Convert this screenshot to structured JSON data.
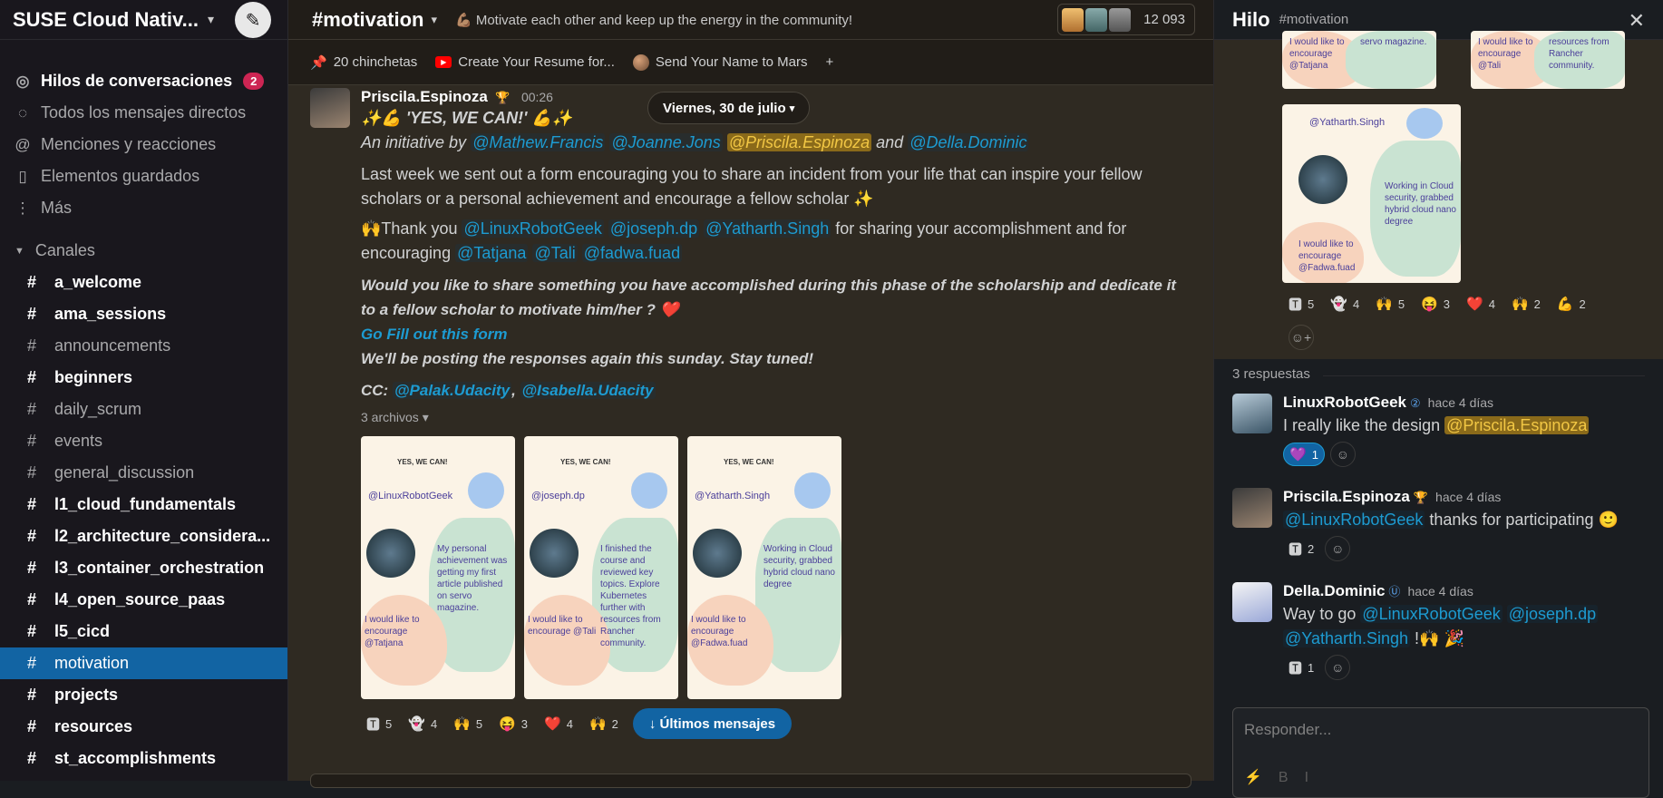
{
  "sidebar": {
    "workspace": "SUSE Cloud Nativ...",
    "nav": [
      {
        "label": "Hilos de conversaciones",
        "icon": "threads-icon",
        "glyph": "◎",
        "bold": true,
        "badge": "2"
      },
      {
        "label": "Todos los mensajes directos",
        "icon": "dm-icon",
        "glyph": "◌",
        "bold": false
      },
      {
        "label": "Menciones y reacciones",
        "icon": "at-icon",
        "glyph": "@",
        "bold": false
      },
      {
        "label": "Elementos guardados",
        "icon": "bookmark-icon",
        "glyph": "▯",
        "bold": false
      },
      {
        "label": "Más",
        "icon": "more-icon",
        "glyph": "⋮",
        "bold": false
      }
    ],
    "section_label": "Canales",
    "channels": [
      {
        "name": "a_welcome",
        "bold": true
      },
      {
        "name": "ama_sessions",
        "bold": true
      },
      {
        "name": "announcements",
        "bold": false
      },
      {
        "name": "beginners",
        "bold": true
      },
      {
        "name": "daily_scrum",
        "bold": false
      },
      {
        "name": "events",
        "bold": false
      },
      {
        "name": "general_discussion",
        "bold": false
      },
      {
        "name": "l1_cloud_fundamentals",
        "bold": true
      },
      {
        "name": "l2_architecture_considera...",
        "bold": true
      },
      {
        "name": "l3_container_orchestration",
        "bold": true
      },
      {
        "name": "l4_open_source_paas",
        "bold": true
      },
      {
        "name": "l5_cicd",
        "bold": true
      },
      {
        "name": "motivation",
        "bold": false,
        "active": true
      },
      {
        "name": "projects",
        "bold": true
      },
      {
        "name": "resources",
        "bold": true
      },
      {
        "name": "st_accomplishments",
        "bold": true
      }
    ]
  },
  "header": {
    "channel": "#motivation",
    "topic": "💪🏽 Motivate each other and keep up the energy in the community!",
    "member_count": "12 093"
  },
  "bookmarks": [
    {
      "label": "20 chinchetas",
      "icon": "pin-icon"
    },
    {
      "label": "Create Your Resume for...",
      "icon": "youtube-icon"
    },
    {
      "label": "Send Your Name to Mars",
      "icon": "planet-icon"
    },
    {
      "label": "+",
      "icon": "add-bookmark-icon"
    }
  ],
  "message": {
    "author": "Priscila.Espinoza",
    "time": "00:26",
    "date_divider": "Viernes, 30 de julio",
    "title": "✨💪 'YES, WE CAN!' 💪✨",
    "initiative_prefix": "An initiative by ",
    "initiative_mentions": [
      "@Mathew.Francis",
      "@Joanne.Jons",
      "@Priscila.Espinoza"
    ],
    "initiative_and": " and ",
    "initiative_last": "@Della.Dominic",
    "para1": "Last week we sent out a form encouraging you to share an incident from your life that can inspire your fellow scholars or a personal achievement and encourage a fellow scholar ✨",
    "thanks_prefix": "🙌Thank you ",
    "thanks_mentions": [
      "@LinuxRobotGeek",
      "@joseph.dp",
      "@Yatharth.Singh"
    ],
    "thanks_mid": " for sharing your accomplishment and for encouraging ",
    "encourage_mentions": [
      "@Tatjana",
      "@Tali",
      "@fadwa.fuad"
    ],
    "question": "Would you like to share something you have accomplished during this phase of the scholarship and dedicate it to a fellow scholar to motivate him/her ? ❤️",
    "form_link": "Go Fill out this form",
    "posting": "We'll be posting the responses again this sunday. Stay tuned!",
    "cc_label": "CC: ",
    "cc_mentions": [
      "@Palak.Udacity",
      "@Isabella.Udacity"
    ],
    "files_label": "3 archivos ▾",
    "files": [
      {
        "title": "YES, WE CAN!",
        "who": "@LinuxRobotGeek",
        "text": "My personal achievement was getting my first article published on servo magazine.",
        "enc": "I would like to encourage @Tatjana"
      },
      {
        "title": "YES, WE CAN!",
        "who": "@joseph.dp",
        "text": "I finished the course and reviewed key topics. Explore Kubernetes further with resources from Rancher community.",
        "enc": "I would like to encourage @Tali"
      },
      {
        "title": "YES, WE CAN!",
        "who": "@Yatharth.Singh",
        "text": "Working in Cloud security, grabbed hybrid cloud nano degree",
        "enc": "I would like to encourage @Fadwa.fuad"
      }
    ],
    "reactions": [
      {
        "emoji": "🆃",
        "count": "5"
      },
      {
        "emoji": "👻",
        "count": "4"
      },
      {
        "emoji": "🙌",
        "count": "5"
      },
      {
        "emoji": "😝",
        "count": "3"
      },
      {
        "emoji": "❤️",
        "count": "4"
      },
      {
        "emoji": "🙌",
        "count": "2"
      }
    ],
    "latest_button": "↓  Últimos mensajes"
  },
  "thread": {
    "title": "Hilo",
    "channel": "#motivation",
    "image_who": "@Yatharth.Singh",
    "image_text": "Working in Cloud security, grabbed hybrid cloud nano degree",
    "image_enc": "I would like to encourage @Fadwa.fuad",
    "top_clip_1": "I would like to encourage @Tatjana",
    "top_clip_2": "servo magazine.",
    "top_clip_3": "I would like to encourage @Tali",
    "top_clip_4": "resources from Rancher community.",
    "parent_reactions": [
      {
        "emoji": "🆃",
        "count": "5"
      },
      {
        "emoji": "👻",
        "count": "4"
      },
      {
        "emoji": "🙌",
        "count": "5"
      },
      {
        "emoji": "😝",
        "count": "3"
      },
      {
        "emoji": "❤️",
        "count": "4"
      },
      {
        "emoji": "🙌",
        "count": "2"
      },
      {
        "emoji": "💪",
        "count": "2"
      }
    ],
    "reply_count": "3 respuestas",
    "replies": [
      {
        "author": "LinuxRobotGeek",
        "time": "hace 4 días",
        "text_prefix": "I really like the design ",
        "mention": "@Priscila.Espinoza",
        "reaction": "💜",
        "count": "1"
      },
      {
        "author": "Priscila.Espinoza",
        "time": "hace 4 días",
        "mention": "@LinuxRobotGeek",
        "text_suffix": " thanks for participating 🙂",
        "reaction": "🆃",
        "count": "2"
      },
      {
        "author": "Della.Dominic",
        "time": "hace 4 días",
        "text_prefix": "Way to go ",
        "mentions": [
          "@LinuxRobotGeek",
          "@joseph.dp",
          "@Yatharth.Singh"
        ],
        "text_suffix": " !🙌 🎉",
        "reaction": "🆃",
        "count": "1"
      }
    ],
    "reply_placeholder": "Responder..."
  },
  "colors": {
    "accent": "#1264a3",
    "mention": "#1d9bd1",
    "badge": "#cd2553"
  }
}
